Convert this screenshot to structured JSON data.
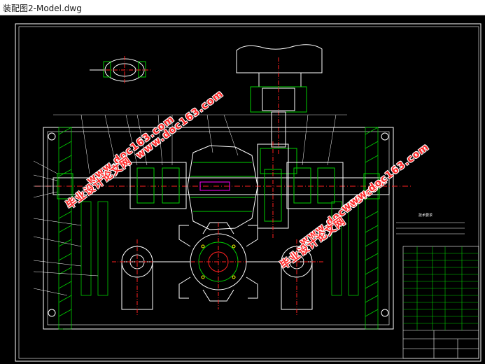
{
  "window": {
    "title": "装配图2-Model.dwg"
  },
  "watermarks": [
    {
      "text": "毕业设计论文网",
      "kind": "cn"
    },
    {
      "text": "www.doc163.com",
      "kind": "url"
    },
    {
      "text": "毕业设计论文网",
      "kind": "cn"
    },
    {
      "text": "www.doc163.com",
      "kind": "url"
    },
    {
      "text": "毕业设计论文网",
      "kind": "cn"
    },
    {
      "text": "www.doc163.com",
      "kind": "url"
    }
  ],
  "drawing": {
    "background": "#000000",
    "line_colors": {
      "outline": "#ffffff",
      "hatch": "#00d000",
      "center": "#ff2020",
      "hidden": "#ffff00",
      "dimension": "#00ffff",
      "accent": "#ff00ff"
    },
    "tech_requirements_heading": "技术要求"
  }
}
